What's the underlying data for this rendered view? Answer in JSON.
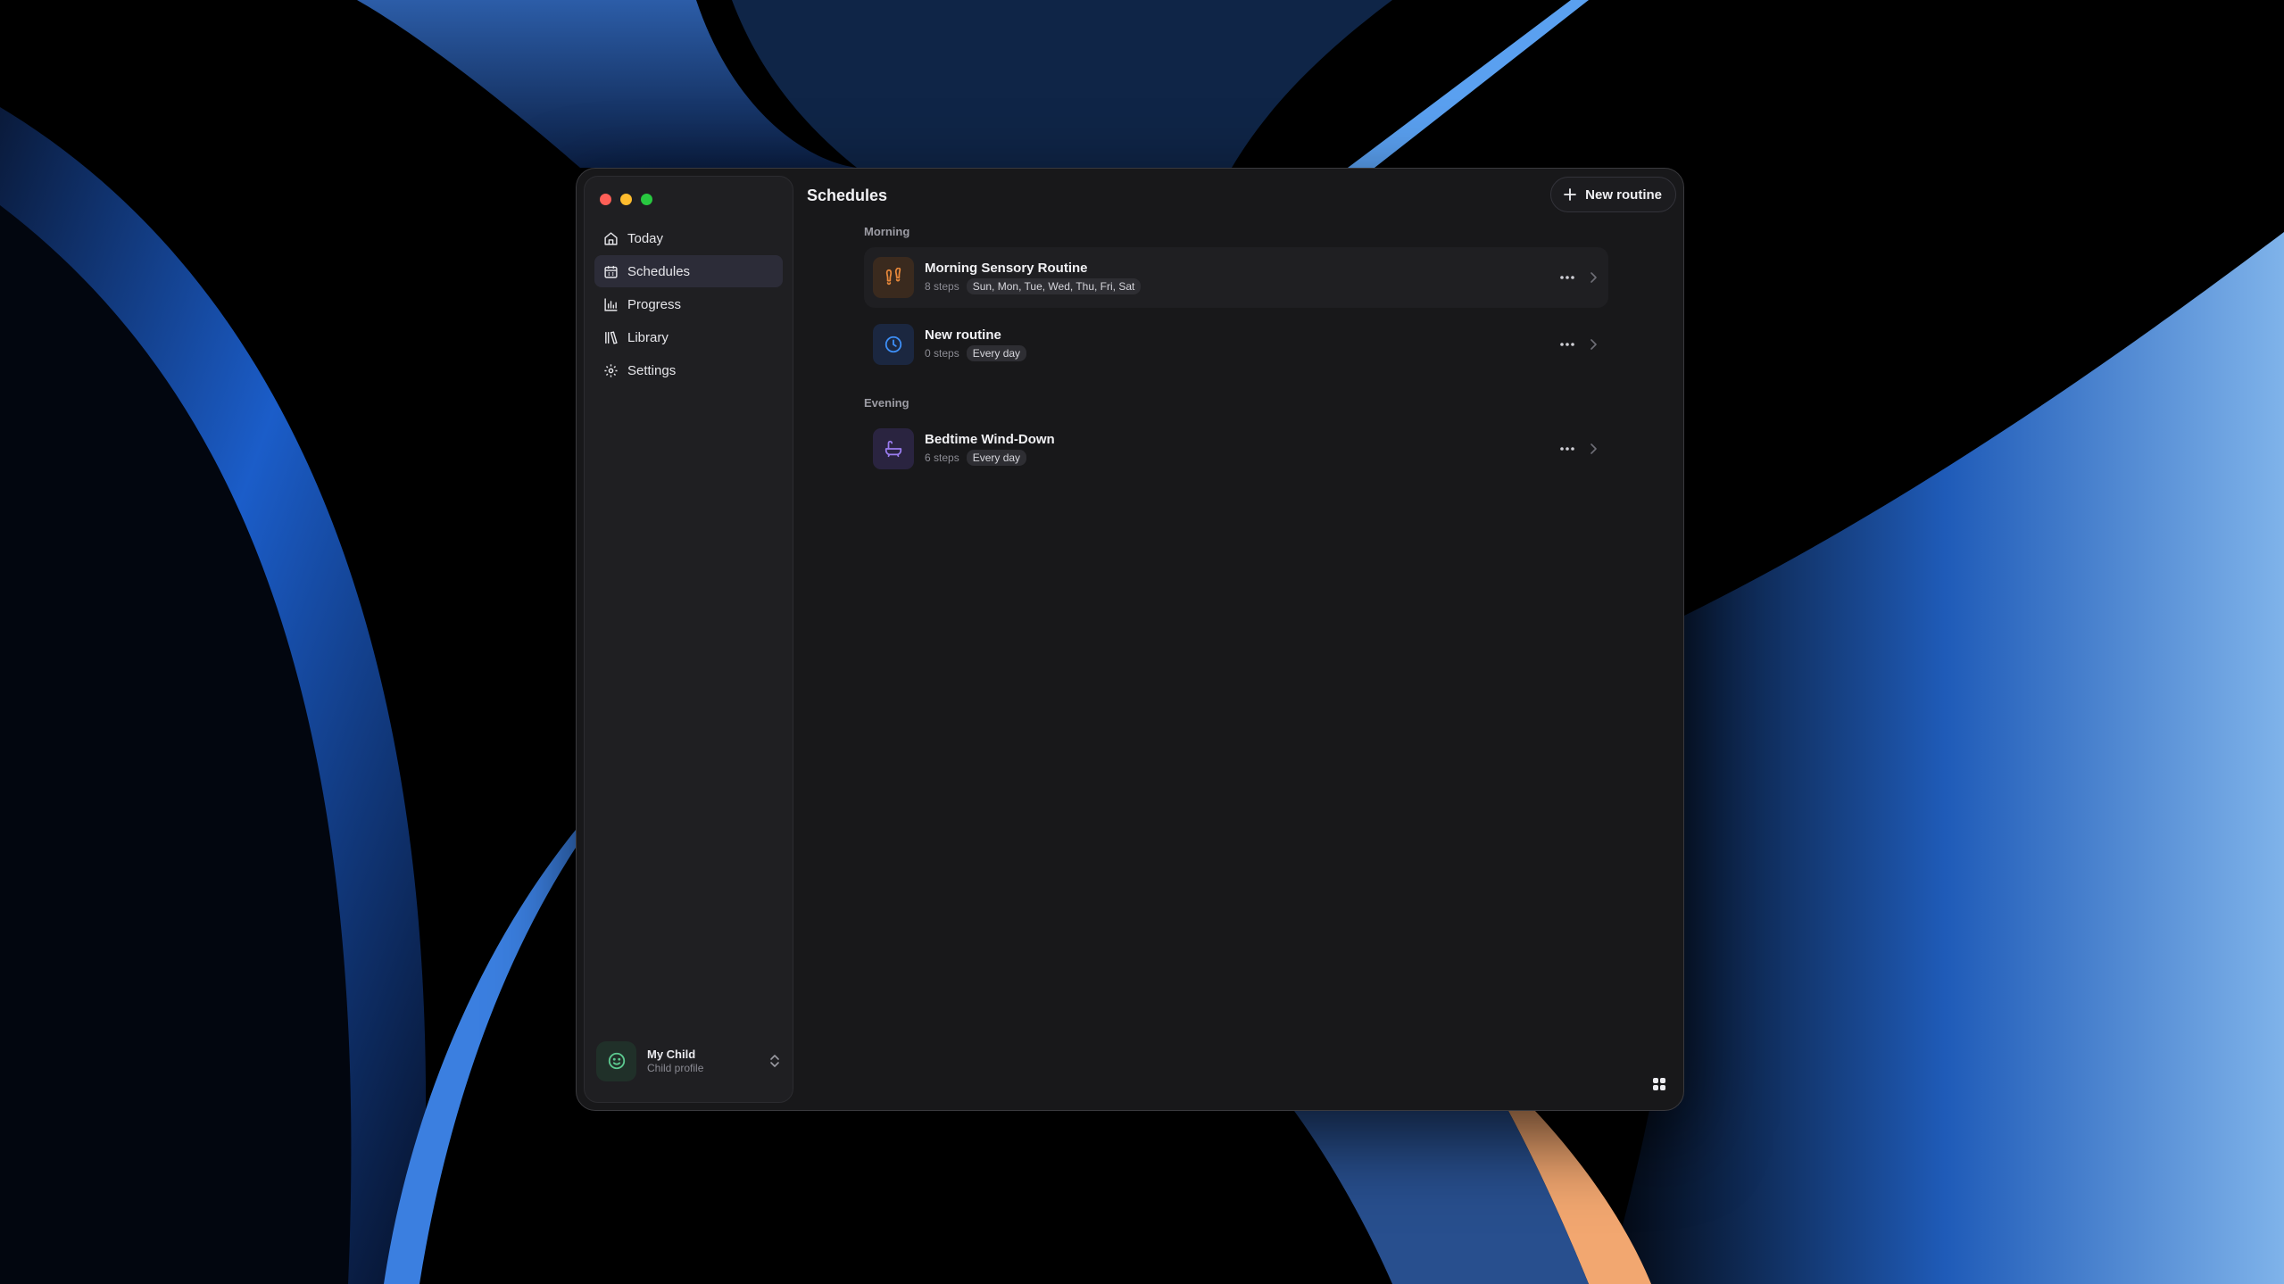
{
  "window": {
    "title": "Schedules"
  },
  "sidebar": {
    "items": [
      {
        "label": "Today",
        "icon": "home-icon",
        "active": false
      },
      {
        "label": "Schedules",
        "icon": "calendar-icon",
        "active": true
      },
      {
        "label": "Progress",
        "icon": "bar-chart-icon",
        "active": false
      },
      {
        "label": "Library",
        "icon": "library-icon",
        "active": false
      },
      {
        "label": "Settings",
        "icon": "gear-icon",
        "active": false
      }
    ],
    "profile": {
      "name": "My Child",
      "subtitle": "Child profile",
      "icon": "smiley-icon"
    }
  },
  "header": {
    "title": "Schedules",
    "new_routine_label": "New routine"
  },
  "sections": [
    {
      "label": "Morning",
      "routines": [
        {
          "title": "Morning Sensory Routine",
          "steps": "8 steps",
          "days": "Sun, Mon, Tue, Wed, Thu, Fri, Sat",
          "icon": "footprints-icon",
          "icon_color": "#e8883a",
          "icon_bg": "#3a2a1e"
        },
        {
          "title": "New routine",
          "steps": "0 steps",
          "days": "Every day",
          "icon": "clock-icon",
          "icon_color": "#3d8ef5",
          "icon_bg": "#1b2740"
        }
      ]
    },
    {
      "label": "Evening",
      "routines": [
        {
          "title": "Bedtime Wind-Down",
          "steps": "6 steps",
          "days": "Every day",
          "icon": "bathtub-icon",
          "icon_color": "#9a7cf0",
          "icon_bg": "#2a2440"
        }
      ]
    }
  ],
  "colors": {
    "accent_active": "#2c2c38",
    "window_bg": "#18181a",
    "sidebar_bg": "#1f1f22"
  }
}
